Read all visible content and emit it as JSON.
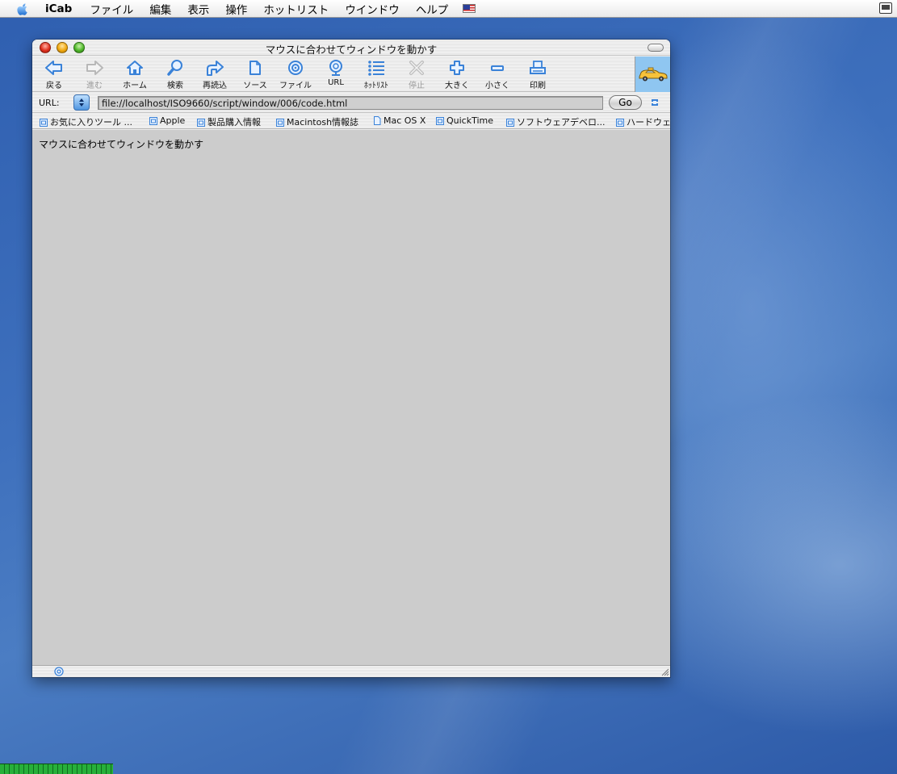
{
  "menubar": {
    "app_name": "iCab",
    "items": [
      "ファイル",
      "編集",
      "表示",
      "操作",
      "ホットリスト",
      "ウインドウ",
      "ヘルプ"
    ]
  },
  "window": {
    "title": "マウスに合わせてウィンドウを動かす"
  },
  "toolbar": {
    "buttons": [
      {
        "label": "戻る",
        "icon": "back-arrow-icon",
        "enabled": true
      },
      {
        "label": "進む",
        "icon": "forward-arrow-icon",
        "enabled": false
      },
      {
        "label": "ホーム",
        "icon": "home-icon",
        "enabled": true
      },
      {
        "label": "検索",
        "icon": "magnifier-icon",
        "enabled": true
      },
      {
        "label": "再読込",
        "icon": "reload-icon",
        "enabled": true
      },
      {
        "label": "ソース",
        "icon": "source-document-icon",
        "enabled": true
      },
      {
        "label": "ファイル",
        "icon": "file-disc-icon",
        "enabled": true
      },
      {
        "label": "URL",
        "icon": "url-globe-icon",
        "enabled": true
      },
      {
        "label": "ﾎｯﾄﾘｽﾄ",
        "icon": "hotlist-icon",
        "enabled": true
      },
      {
        "label": "停止",
        "icon": "stop-x-icon",
        "enabled": false
      },
      {
        "label": "大きく",
        "icon": "plus-icon",
        "enabled": true
      },
      {
        "label": "小さく",
        "icon": "minus-icon",
        "enabled": true
      },
      {
        "label": "印刷",
        "icon": "printer-icon",
        "enabled": true
      }
    ]
  },
  "urlbar": {
    "label": "URL:",
    "value": "file://localhost/ISO9660/script/window/006/code.html",
    "go_label": "Go"
  },
  "bookmarks": [
    "お気に入りツール ...",
    "Apple",
    "製品購入情報",
    "Macintosh情報誌",
    "Mac OS X",
    "QuickTime",
    "ソフトウェアデベロ...",
    "ハードウェ"
  ],
  "content": {
    "text": "マウスに合わせてウィンドウを動かす",
    "background": "#cccccc"
  },
  "colors": {
    "desktop": "#3d6db5",
    "icon_blue": "#3a82d8",
    "progress_green": "#27b03a"
  }
}
